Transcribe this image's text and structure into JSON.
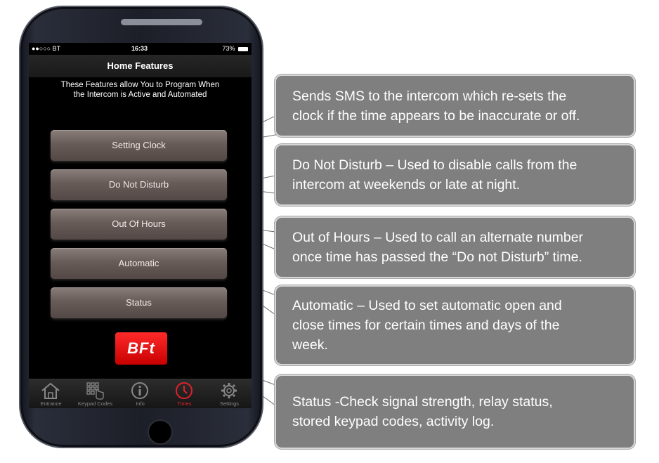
{
  "status_bar": {
    "carrier": "●●○○○ BT",
    "time": "16:33",
    "battery": "73%"
  },
  "screen": {
    "title": "Home Features",
    "intro_line1": "These Features allow You to Program When",
    "intro_line2": "the Intercom is Active and Automated"
  },
  "features": [
    {
      "label": "Setting Clock"
    },
    {
      "label": "Do Not Disturb"
    },
    {
      "label": "Out Of Hours"
    },
    {
      "label": "Automatic"
    },
    {
      "label": "Status"
    }
  ],
  "logo": {
    "text": "BFt"
  },
  "tabs": [
    {
      "label": "Entrance",
      "icon": "house-icon"
    },
    {
      "label": "Keypad Codes",
      "icon": "keypad-icon"
    },
    {
      "label": "Info",
      "icon": "info-icon"
    },
    {
      "label": "Times",
      "icon": "clock-icon",
      "active": true
    },
    {
      "label": "Settings",
      "icon": "gear-icon"
    }
  ],
  "callouts": [
    {
      "line1": "Sends SMS to the intercom which re-sets the",
      "line2": "clock if the time appears to be inaccurate or off.",
      "line3": ""
    },
    {
      "line1": "Do Not Disturb – Used to disable calls from the",
      "line2": "intercom at weekends or late at night.",
      "line3": ""
    },
    {
      "line1": "Out of Hours – Used to call an alternate number",
      "line2": "once time has passed the “Do not Disturb” time.",
      "line3": ""
    },
    {
      "line1": "Automatic – Used to set automatic open and",
      "line2": "close times for certain times and days of the",
      "line3": "week."
    },
    {
      "line1": "Status -Check signal strength, relay status,",
      "line2": "stored keypad codes, activity log.",
      "line3": ""
    }
  ],
  "colors": {
    "callout_bg": "#7f7f7f",
    "button_bg": "#685c59",
    "active_tab": "#e0212b",
    "logo_red": "#e60000"
  }
}
